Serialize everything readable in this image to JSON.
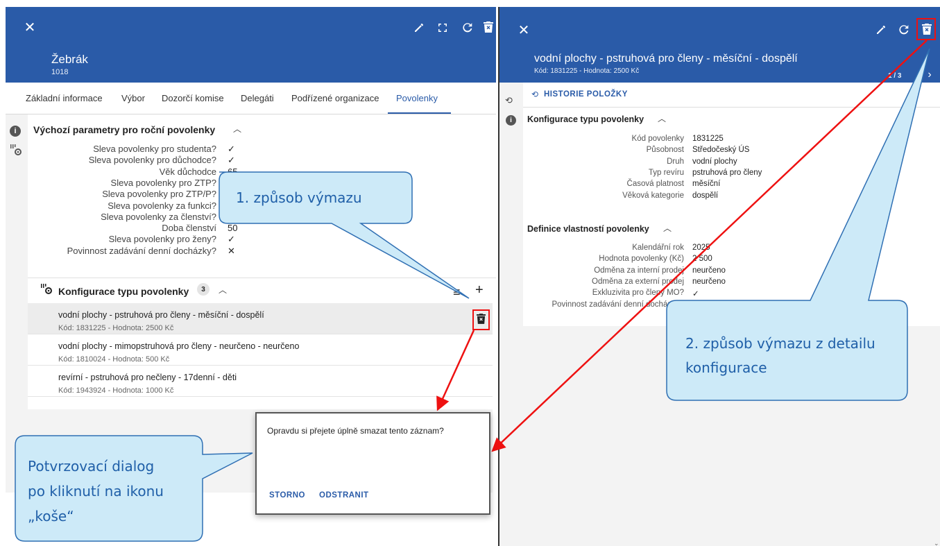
{
  "left": {
    "header": {
      "title": "Žebrák",
      "subtitle": "1018"
    },
    "tabs": [
      "Základní informace",
      "Výbor",
      "Dozorčí komise",
      "Delegáti",
      "Podřízené organizace",
      "Povolenky"
    ],
    "defaults_section": {
      "title": "Výchozí parametry pro roční povolenky",
      "rows": [
        {
          "label": "Sleva povolenky pro studenta?",
          "value": "✓"
        },
        {
          "label": "Sleva povolenky pro důchodce?",
          "value": "✓"
        },
        {
          "label": "Věk důchodce",
          "value": "65"
        },
        {
          "label": "Sleva povolenky pro ZTP?",
          "value": "✓"
        },
        {
          "label": "Sleva povolenky pro ZTP/P?",
          "value": "✓"
        },
        {
          "label": "Sleva povolenky za funkci?",
          "value": "✓"
        },
        {
          "label": "Sleva povolenky za členství?",
          "value": "✓"
        },
        {
          "label": "Doba členství",
          "value": "50"
        },
        {
          "label": "Sleva povolenky pro ženy?",
          "value": "✓"
        },
        {
          "label": "Povinnost zadávání denní docházky?",
          "value": "✕"
        }
      ]
    },
    "config_section": {
      "title": "Konfigurace typu povolenky",
      "count": "3"
    },
    "items": [
      {
        "title": "vodní plochy - pstruhová pro členy - měsíční - dospělí",
        "sub": "Kód: 1831225 - Hodnota: 2500 Kč"
      },
      {
        "title": "vodní plochy - mimopstruhová pro členy - neurčeno - neurčeno",
        "sub": "Kód: 1810024 - Hodnota: 500 Kč"
      },
      {
        "title": "revírní - pstruhová pro nečleny - 17denní - děti",
        "sub": "Kód: 1943924 - Hodnota: 1000 Kč"
      }
    ]
  },
  "right": {
    "header": {
      "title": "vodní plochy - pstruhová pro členy - měsíční - dospělí",
      "subtitle": "Kód: 1831225 - Hodnota: 2500 Kč",
      "pager": "1 / 3"
    },
    "history_label": "HISTORIE POLOŽKY",
    "config": {
      "title": "Konfigurace typu povolenky",
      "rows": [
        {
          "label": "Kód povolenky",
          "value": "1831225"
        },
        {
          "label": "Působnost",
          "value": "Středočeský ÚS"
        },
        {
          "label": "Druh",
          "value": "vodní plochy"
        },
        {
          "label": "Typ revíru",
          "value": "pstruhová pro členy"
        },
        {
          "label": "Časová platnost",
          "value": "měsíční"
        },
        {
          "label": "Věková kategorie",
          "value": "dospělí"
        }
      ]
    },
    "props": {
      "title": "Definice vlastností povolenky",
      "rows": [
        {
          "label": "Kalendářní rok",
          "value": "2025"
        },
        {
          "label": "Hodnota povolenky (Kč)",
          "value": "2 500"
        },
        {
          "label": "Odměna za interní prodej",
          "value": "neurčeno"
        },
        {
          "label": "Odměna za externí prodej",
          "value": "neurčeno"
        },
        {
          "label": "Exkluzivita pro členy MO?",
          "value": "✓"
        },
        {
          "label": "Povinnost zadávání denní docházky?",
          "value": ""
        }
      ]
    }
  },
  "dialog": {
    "question": "Opravdu si přejete úplně smazat tento záznam?",
    "cancel": "STORNO",
    "confirm": "ODSTRANIT"
  },
  "callouts": {
    "first": "1. způsob výmazu",
    "second_line1": "2. způsob výmazu z detailu",
    "second_line2": "konfigurace",
    "third_line1": "Potvrzovací dialog",
    "third_line2": "po kliknutí na ikonu",
    "third_line3": "„koše“"
  },
  "colors": {
    "header": "#2a5ba8",
    "accent": "#2a5ba8",
    "callout_fill": "#cdeaf8",
    "callout_stroke": "#2f6fb3",
    "arrow": "#e11"
  }
}
